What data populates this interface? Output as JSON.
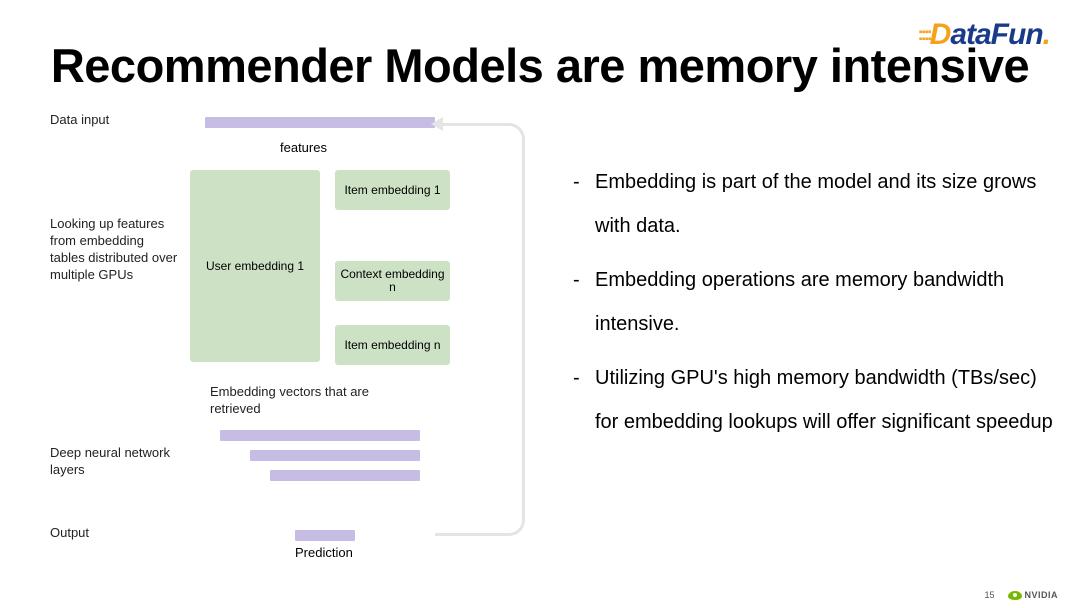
{
  "branding": {
    "datafun_dots": "::::",
    "datafun_d": "D",
    "datafun_rest": "ataFun",
    "datafun_period": "."
  },
  "title": "Recommender Models are memory intensive",
  "diagram": {
    "labels": {
      "data_input": "Data input",
      "lookup": "Looking up features from embedding tables distributed over multiple GPUs",
      "retrieved": "Embedding vectors that are retrieved",
      "dnn": "Deep neural network layers",
      "output": "Output",
      "features": "features",
      "prediction": "Prediction"
    },
    "embeddings": {
      "user": "User embedding 1",
      "item1": "Item embedding 1",
      "contextn": "Context embedding n",
      "itemn": "Item embedding n"
    }
  },
  "bullets": [
    "Embedding is part of the model and its size grows with data.",
    "Embedding operations are memory bandwidth intensive.",
    "Utilizing GPU's high memory bandwidth (TBs/sec) for embedding lookups will offer significant speedup"
  ],
  "footer": {
    "page": "15",
    "brand": "NVIDIA"
  }
}
